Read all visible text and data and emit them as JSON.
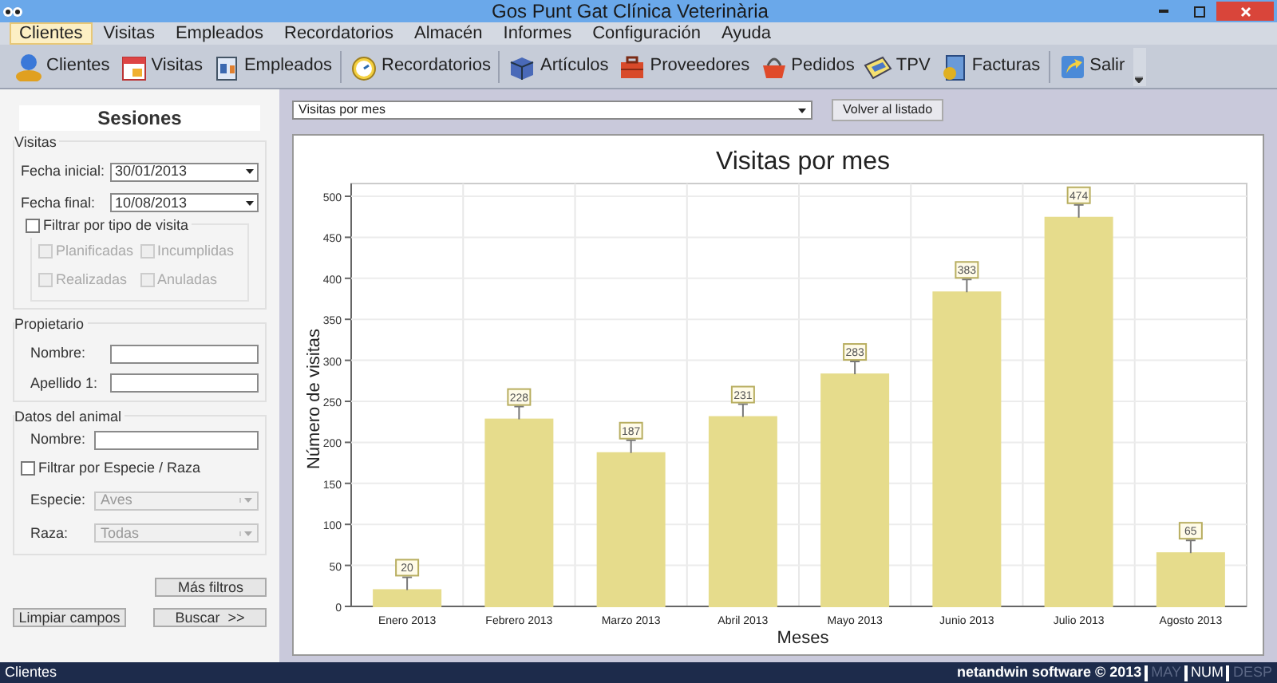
{
  "window": {
    "title": "Gos Punt Gat Clínica Veterinària"
  },
  "menu": [
    {
      "label": "Clientes",
      "selected": true
    },
    {
      "label": "Visitas",
      "selected": false
    },
    {
      "label": "Empleados",
      "selected": false
    },
    {
      "label": "Recordatorios",
      "selected": false
    },
    {
      "label": "Almacén",
      "selected": false
    },
    {
      "label": "Informes",
      "selected": false
    },
    {
      "label": "Configuración",
      "selected": false
    },
    {
      "label": "Ayuda",
      "selected": false
    }
  ],
  "toolbar": [
    "Clientes",
    "Visitas",
    "Empleados",
    "Recordatorios",
    "Artículos",
    "Proveedores",
    "Pedidos",
    "TPV",
    "Facturas",
    "Salir"
  ],
  "sidebar": {
    "title": "Sesiones",
    "visitas": {
      "legend": "Visitas",
      "fecha_inicial": {
        "label": "Fecha inicial:",
        "value": "30/01/2013"
      },
      "fecha_final": {
        "label": "Fecha final:",
        "value": "10/08/2013"
      },
      "filter": {
        "label": "Filtrar por tipo de visita",
        "checked": false
      },
      "types": [
        {
          "label": "Planificadas",
          "checked": false,
          "disabled": true
        },
        {
          "label": "Incumplidas",
          "checked": false,
          "disabled": true
        },
        {
          "label": "Realizadas",
          "checked": false,
          "disabled": true
        },
        {
          "label": "Anuladas",
          "checked": false,
          "disabled": true
        }
      ]
    },
    "propietario": {
      "legend": "Propietario",
      "fields": [
        {
          "label": "Nombre:"
        },
        {
          "label": "Apellido 1:"
        }
      ]
    },
    "animal": {
      "legend": "Datos del animal",
      "nombre": {
        "label": "Nombre:"
      },
      "filter": {
        "label": "Filtrar por Especie / Raza",
        "checked": false
      },
      "combos": [
        {
          "label": "Especie:",
          "value": "Aves",
          "disabled": true
        },
        {
          "label": "Raza:",
          "value": "Todas",
          "disabled": true
        }
      ]
    },
    "buttons": {
      "mas": "Más filtros",
      "limpiar": "Limpiar campos",
      "buscar": "Buscar  >>"
    }
  },
  "report": {
    "selector": "Visitas por mes",
    "back": "Volver al listado",
    "chart_data": {
      "type": "bar",
      "title": "Visitas por mes",
      "xlabel": "Meses",
      "ylabel": "Número de visitas",
      "categories": [
        "Enero 2013",
        "Febrero 2013",
        "Marzo 2013",
        "Abril 2013",
        "Mayo 2013",
        "Junio 2013",
        "Julio 2013",
        "Agosto 2013"
      ],
      "series": [
        {
          "color": "#e6dc8c",
          "values": [
            20,
            228,
            187,
            231,
            283,
            383,
            474,
            65
          ]
        }
      ],
      "ylim": [
        0,
        500
      ],
      "yticks": [
        0,
        50,
        100,
        150,
        200,
        250,
        300,
        350,
        400,
        450,
        500
      ],
      "data_labels": true,
      "grid": true
    }
  },
  "status_bar": {
    "left": "Clientes",
    "copyright": "netandwin software © 2013",
    "keys": [
      {
        "label": "MAY",
        "active": false
      },
      {
        "label": "NUM",
        "active": true
      },
      {
        "label": "DESP",
        "active": false
      }
    ]
  }
}
